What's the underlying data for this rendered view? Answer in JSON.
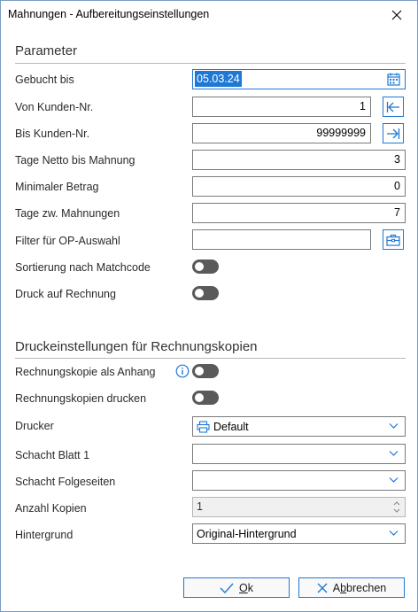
{
  "window": {
    "title": "Mahnungen - Aufbereitungseinstellungen"
  },
  "parameter": {
    "heading": "Parameter",
    "gebucht_bis": {
      "label": "Gebucht bis",
      "value": "05.03.24"
    },
    "von_kunden": {
      "label": "Von Kunden-Nr.",
      "value": "1"
    },
    "bis_kunden": {
      "label": "Bis Kunden-Nr.",
      "value": "99999999"
    },
    "tage_netto": {
      "label": "Tage Netto bis Mahnung",
      "value": "3"
    },
    "min_betrag": {
      "label": "Minimaler Betrag",
      "value": "0"
    },
    "tage_zw": {
      "label": "Tage zw. Mahnungen",
      "value": "7"
    },
    "filter": {
      "label": "Filter für OP-Auswahl",
      "value": ""
    },
    "sortierung": {
      "label": "Sortierung nach Matchcode",
      "on": false
    },
    "druck_rechnung": {
      "label": "Druck auf Rechnung",
      "on": false
    }
  },
  "druck": {
    "heading": "Druckeinstellungen für Rechnungskopien",
    "anhang": {
      "label": "Rechnungskopie als Anhang",
      "on": false
    },
    "kopien_drucken": {
      "label": "Rechnungskopien drucken",
      "on": false
    },
    "drucker": {
      "label": "Drucker",
      "value": "Default"
    },
    "schacht1": {
      "label": "Schacht Blatt 1",
      "value": ""
    },
    "schacht_folge": {
      "label": "Schacht Folgeseiten",
      "value": ""
    },
    "anzahl": {
      "label": "Anzahl Kopien",
      "value": "1"
    },
    "hintergrund": {
      "label": "Hintergrund",
      "value": "Original-Hintergrund"
    }
  },
  "buttons": {
    "ok_pre": "",
    "ok_u": "O",
    "ok_post": "k",
    "abbrechen_pre": "A",
    "abbrechen_u": "b",
    "abbrechen_post": "brechen"
  },
  "colors": {
    "accent": "#1e78d4",
    "toggle_off": "#5a5a5a"
  }
}
